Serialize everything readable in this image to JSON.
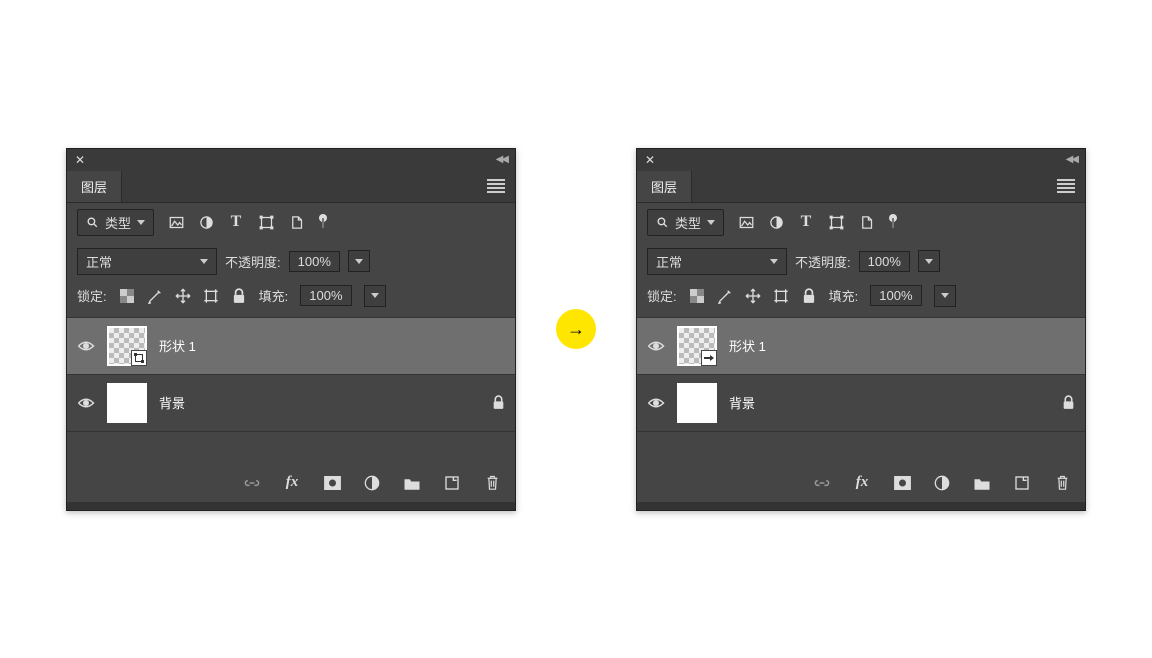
{
  "left": {
    "tab": "图层",
    "type_filter": "类型",
    "blend_mode": "正常",
    "opacity_label": "不透明度:",
    "opacity_value": "100%",
    "lock_label": "锁定:",
    "fill_label": "填充:",
    "fill_value": "100%",
    "layers": [
      {
        "name": "形状 1",
        "selected": true,
        "thumb": "checker",
        "badge": "square",
        "locked": false
      },
      {
        "name": "背景",
        "selected": false,
        "thumb": "white",
        "badge": "none",
        "locked": true
      }
    ]
  },
  "right": {
    "tab": "图层",
    "type_filter": "类型",
    "blend_mode": "正常",
    "opacity_label": "不透明度:",
    "opacity_value": "100%",
    "lock_label": "锁定:",
    "fill_label": "填充:",
    "fill_value": "100%",
    "layers": [
      {
        "name": "形状 1",
        "selected": true,
        "thumb": "checker",
        "badge": "arrow",
        "locked": false
      },
      {
        "name": "背景",
        "selected": false,
        "thumb": "white",
        "badge": "none",
        "locked": true
      }
    ]
  },
  "footer_fx": "fx"
}
